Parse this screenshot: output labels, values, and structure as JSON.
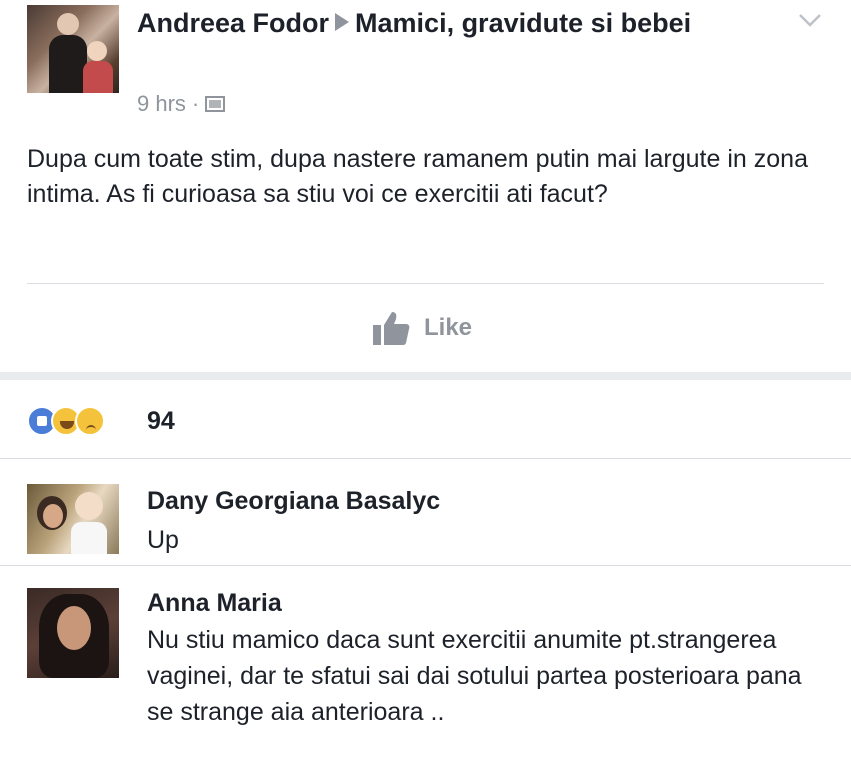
{
  "post": {
    "author": "Andreea Fodor",
    "group": "Mamici, gravidute si bebei",
    "time": "9 hrs",
    "audience_icon": "group-audience-icon",
    "text": "Dupa cum toate stim,  dupa nastere ramanem putin mai largute in zona intima.  As fi curioasa sa stiu voi ce exercitii ati facut?",
    "like_label": "Like"
  },
  "reactions": {
    "icons": [
      "like-reaction-icon",
      "haha-reaction-icon",
      "sad-reaction-icon"
    ],
    "count": "94"
  },
  "comments": [
    {
      "author": "Dany Georgiana Basalyc",
      "text": "Up"
    },
    {
      "author": "Anna Maria",
      "text": "Nu stiu mamico daca sunt exercitii anumite pt.strangerea vaginei, dar te sfatui sai dai sotului partea posterioara pana se strange aia anterioara .."
    }
  ],
  "colors": {
    "text": "#1d2129",
    "secondary": "#90949c",
    "divider": "#dadde1",
    "like_blue": "#4a7dd8",
    "reaction_yellow": "#f5c33b"
  }
}
